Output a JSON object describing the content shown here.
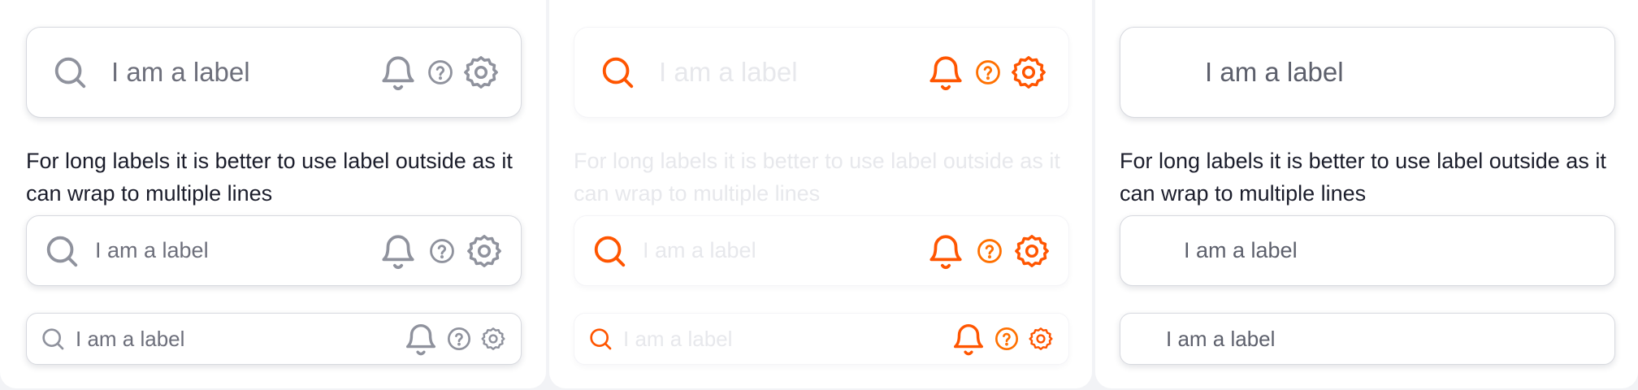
{
  "field_label": "I am a label",
  "helper_text": "For long labels it is better to use label outside as it can wrap to multiple lines",
  "icons": {
    "leading": "search-icon",
    "trailing": [
      "bell-icon",
      "help-circle-icon",
      "gear-icon"
    ]
  },
  "colors": {
    "text": "#1b1d2b",
    "icon": "#8f929d",
    "accent": "#ff5500",
    "border": "#d7d9df"
  }
}
